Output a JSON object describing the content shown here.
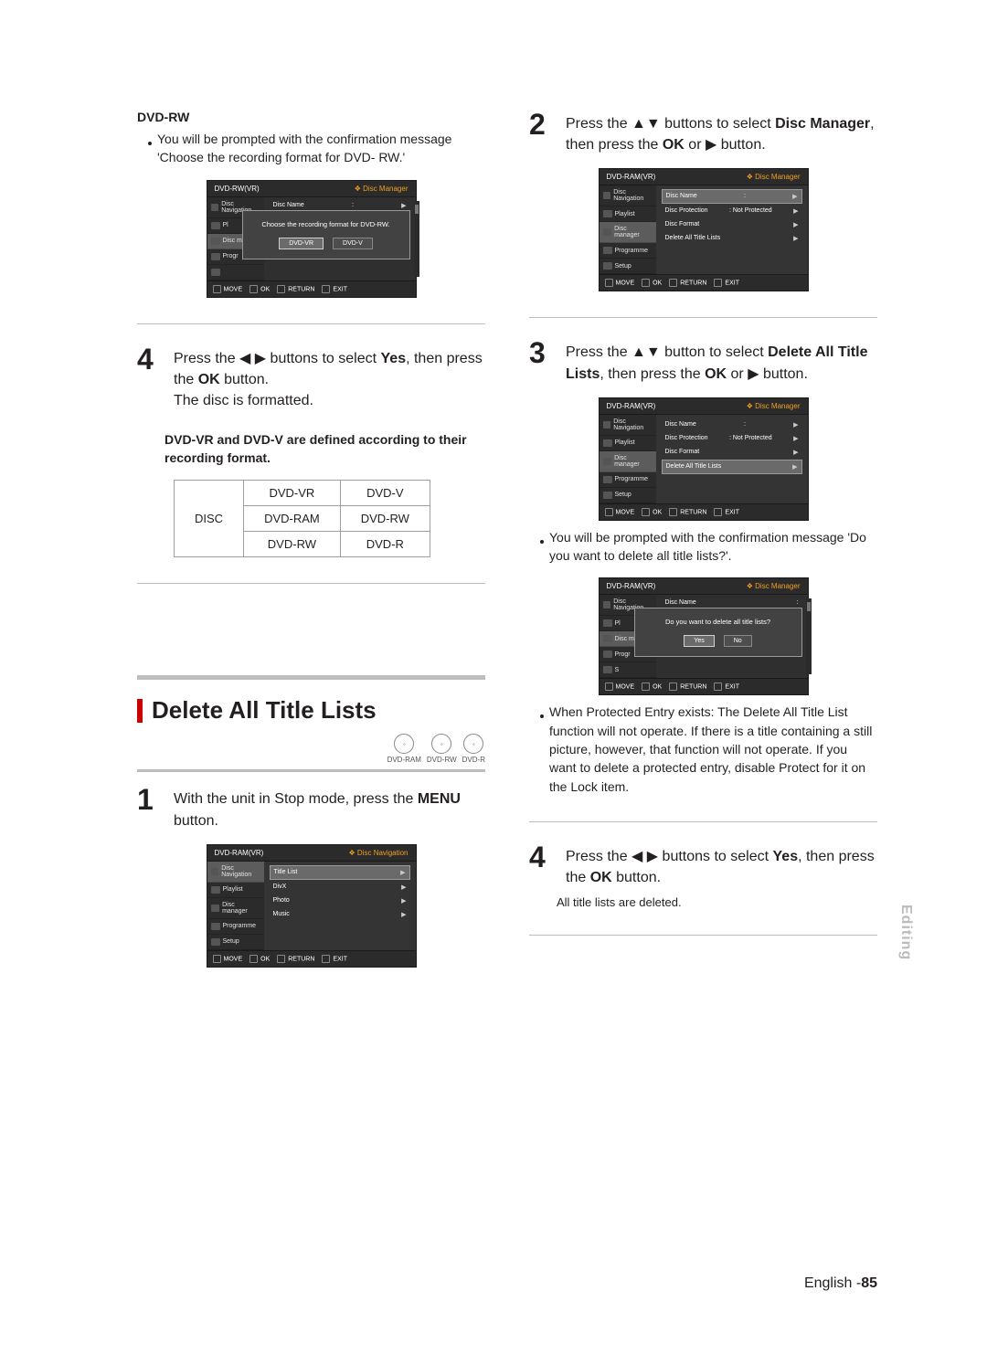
{
  "left": {
    "dvd_rw_label": "DVD-RW",
    "dvd_rw_bullet": "You will be prompted with the confirmation message 'Choose the recording format for DVD- RW.'",
    "osd_format": {
      "title_left": "DVD-RW(VR)",
      "title_right": "Disc Manager",
      "side": [
        "Disc Navigation",
        "Pl",
        "Disc man",
        "Progr",
        ""
      ],
      "top_row": "Disc Name",
      "dialog_msg": "Choose the recording format for DVD-RW.",
      "btn1": "DVD-VR",
      "btn2": "DVD-V",
      "foot": [
        "MOVE",
        "OK",
        "RETURN",
        "EXIT"
      ]
    },
    "step4_num": "4",
    "step4_text_a": "Press the ",
    "step4_text_b": " buttons to select ",
    "step4_yes": "Yes",
    "step4_text_c": ", then press the ",
    "step4_ok": "OK",
    "step4_text_d": " button.",
    "step4_line2": "The disc is formatted.",
    "note_bold": "DVD-VR and DVD-V are defined according to their recording format.",
    "matrix": {
      "h1": "DVD-VR",
      "h2": "DVD-V",
      "r1c0": "DISC",
      "r1c1": "DVD-RAM",
      "r1c2": "DVD-RW",
      "r2c1": "DVD-RW",
      "r2c2": "DVD-R"
    },
    "section_title": "Delete All Title Lists",
    "badges": [
      "DVD-RAM",
      "DVD-RW",
      "DVD-R"
    ],
    "step1_num": "1",
    "step1_text_a": "With the unit in Stop mode, press the ",
    "step1_menu": "MENU",
    "step1_text_b": " button.",
    "osd_nav": {
      "title_left": "DVD-RAM(VR)",
      "title_right": "Disc Navigation",
      "side": [
        "Disc Navigation",
        "Playlist",
        "Disc manager",
        "Programme",
        "Setup"
      ],
      "rows": [
        "Title List",
        "DivX",
        "Photo",
        "Music"
      ],
      "foot": [
        "MOVE",
        "OK",
        "RETURN",
        "EXIT"
      ]
    }
  },
  "right": {
    "step2_num": "2",
    "step2_a": "Press the ",
    "step2_b": " buttons to select ",
    "step2_disc": "Disc Manager",
    "step2_c": ", then press the ",
    "step2_ok": "OK",
    "step2_d": " or ",
    "step2_e": " button.",
    "osd_dm": {
      "title_left": "DVD-RAM(VR)",
      "title_right": "Disc Manager",
      "side": [
        "Disc Navigation",
        "Playlist",
        "Disc manager",
        "Programme",
        "Setup"
      ],
      "rows": [
        {
          "l": "Disc Name",
          "r": ":"
        },
        {
          "l": "Disc Protection",
          "r": ": Not Protected"
        },
        {
          "l": "Disc Format",
          "r": ""
        },
        {
          "l": "Delete All Title Lists",
          "r": ""
        }
      ],
      "foot": [
        "MOVE",
        "OK",
        "RETURN",
        "EXIT"
      ]
    },
    "step3_num": "3",
    "step3_a": "Press the ",
    "step3_b": " button to select ",
    "step3_item": "Delete All Title Lists",
    "step3_c": ", then press the ",
    "step3_ok": "OK",
    "step3_d": " or ",
    "step3_e": " button.",
    "osd_dm2": {
      "title_left": "DVD-RAM(VR)",
      "title_right": "Disc Manager",
      "rows_hlidx": 3,
      "foot": [
        "MOVE",
        "OK",
        "RETURN",
        "EXIT"
      ]
    },
    "bullet1": "You will be prompted with the confirmation message 'Do you want to delete all title lists?'.",
    "osd_confirm": {
      "title_left": "DVD-RAM(VR)",
      "title_right": "Disc Manager",
      "top_row": "Disc Name",
      "dialog_msg": "Do you want to delete all title lists?",
      "btn1": "Yes",
      "btn2": "No",
      "foot": [
        "MOVE",
        "OK",
        "RETURN",
        "EXIT"
      ]
    },
    "bullet2": "When Protected Entry exists: The Delete All Title List function will not operate. If there is a title containing a still picture, however, that function will not operate. If you want to delete a protected entry, disable Protect for it on the Lock item.",
    "step4_num": "4",
    "step4_a": "Press the ",
    "step4_b": " buttons to select ",
    "step4_yes": "Yes",
    "step4_c": ", then press the ",
    "step4_ok": "OK",
    "step4_d": " button.",
    "smallnote": "All title lists are deleted."
  },
  "sidetab": "Editing",
  "footer": {
    "lang": "English -",
    "page": "85"
  }
}
